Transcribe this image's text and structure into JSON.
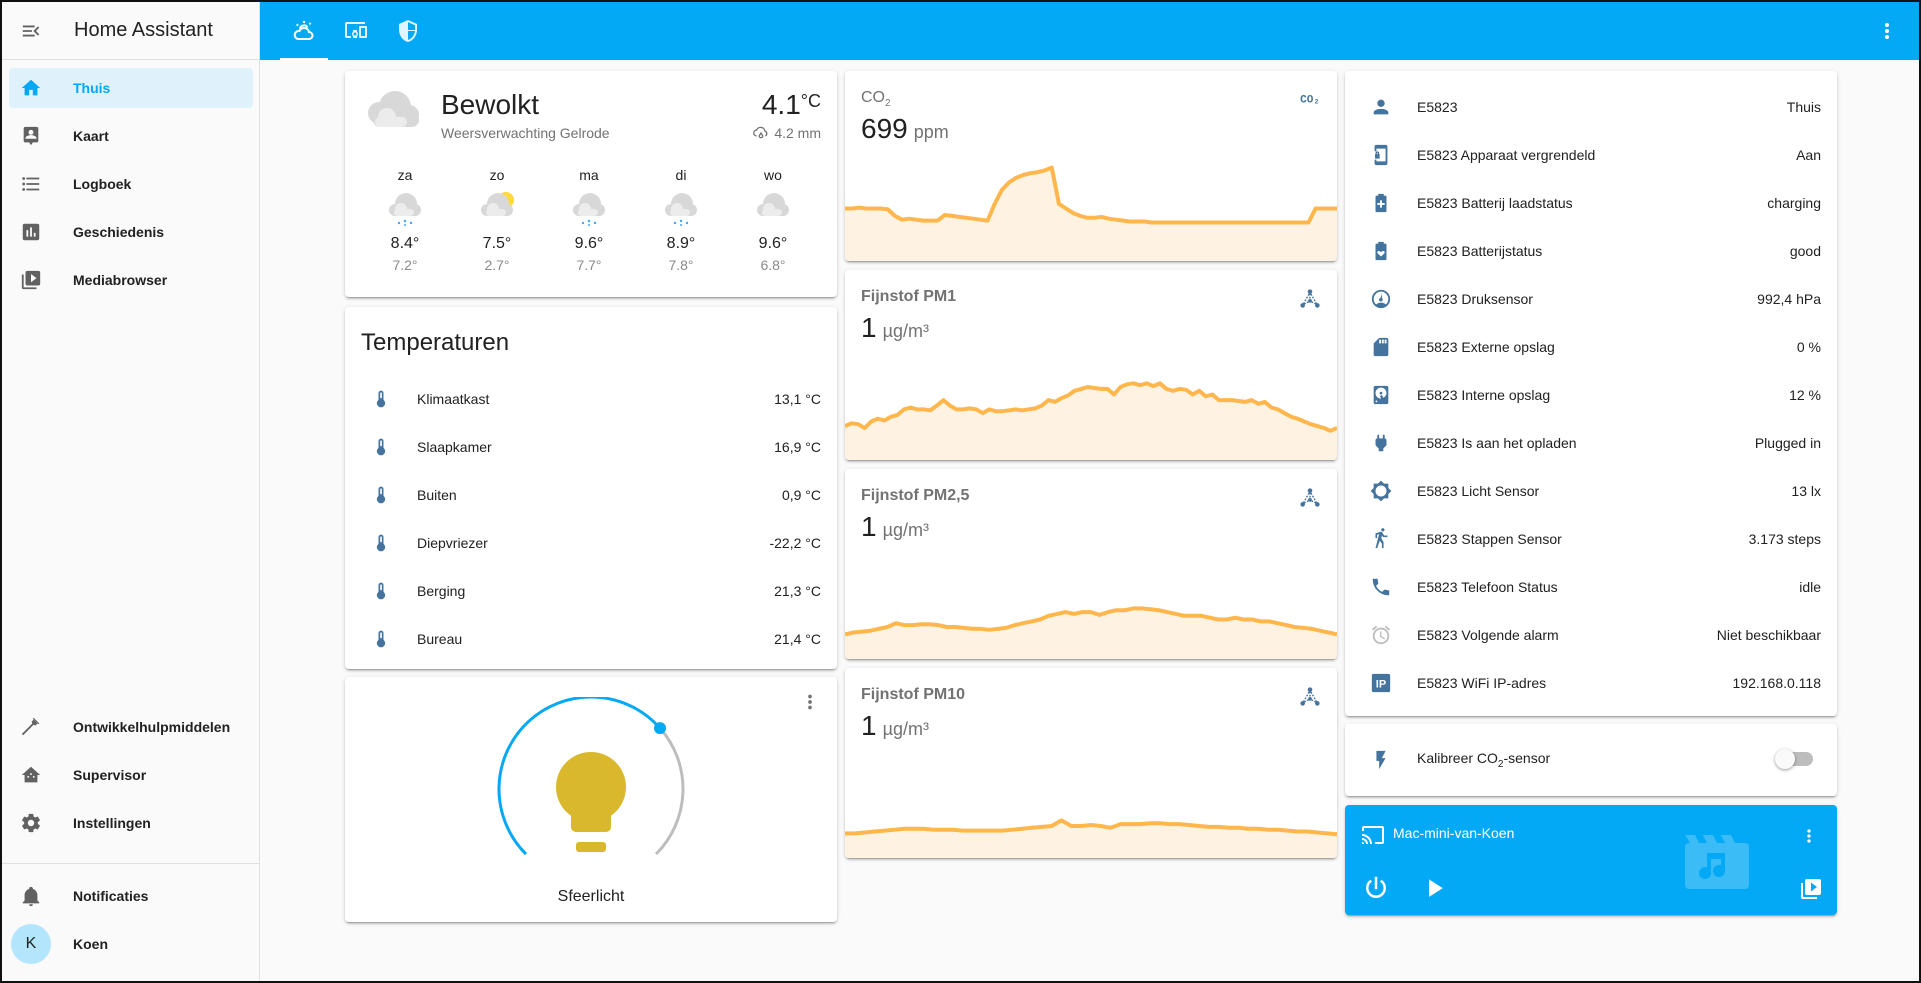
{
  "app": {
    "title": "Home Assistant"
  },
  "sidebar": {
    "items": [
      {
        "label": "Thuis",
        "icon": "home-icon",
        "active": true
      },
      {
        "label": "Kaart",
        "icon": "account-box-icon"
      },
      {
        "label": "Logboek",
        "icon": "format-list-bulleted-icon"
      },
      {
        "label": "Geschiedenis",
        "icon": "chart-box-icon"
      },
      {
        "label": "Mediabrowser",
        "icon": "play-box-multiple-icon"
      }
    ],
    "bottom_items": [
      {
        "label": "Ontwikkelhulpmiddelen",
        "icon": "hammer-icon"
      },
      {
        "label": "Supervisor",
        "icon": "home-assistant-icon"
      },
      {
        "label": "Instellingen",
        "icon": "cog-icon"
      }
    ],
    "notifications_label": "Notificaties",
    "user": {
      "name": "Koen",
      "initial": "K"
    }
  },
  "topbar": {
    "tabs": [
      {
        "icon": "weather-partly-cloudy-icon",
        "active": true
      },
      {
        "icon": "devices-icon"
      },
      {
        "icon": "shield-half-icon"
      }
    ]
  },
  "weather": {
    "condition": "Bewolkt",
    "location": "Weersverwachting Gelrode",
    "temperature": "4.1",
    "temperature_unit": "°C",
    "precipitation": "4.2 mm",
    "forecast": [
      {
        "day": "za",
        "icon": "snowy-cloud",
        "high": "8.4°",
        "low": "7.2°"
      },
      {
        "day": "zo",
        "icon": "partly-cloudy",
        "high": "7.5°",
        "low": "2.7°"
      },
      {
        "day": "ma",
        "icon": "snowy-cloud",
        "high": "9.6°",
        "low": "7.7°"
      },
      {
        "day": "di",
        "icon": "snowy-cloud",
        "high": "8.9°",
        "low": "7.8°"
      },
      {
        "day": "wo",
        "icon": "cloudy",
        "high": "9.6°",
        "low": "6.8°"
      }
    ]
  },
  "temperatures": {
    "title": "Temperaturen",
    "rows": [
      {
        "name": "Klimaatkast",
        "value": "13,1 °C"
      },
      {
        "name": "Slaapkamer",
        "value": "16,9 °C"
      },
      {
        "name": "Buiten",
        "value": "0,9 °C"
      },
      {
        "name": "Diepvriezer",
        "value": "-22,2 °C"
      },
      {
        "name": "Berging",
        "value": "21,3 °C"
      },
      {
        "name": "Bureau",
        "value": "21,4 °C"
      }
    ]
  },
  "light": {
    "name": "Sfeerlicht",
    "brightness_percent": 68,
    "color": "#d9b82e",
    "accent": "#03a9f4"
  },
  "sensors": [
    {
      "name": "CO",
      "name_sub": "2",
      "value": "699",
      "unit": "ppm",
      "icon": "molecule-co2-icon",
      "history": [
        50,
        50,
        51,
        50,
        50,
        50,
        49,
        42,
        38,
        39,
        38,
        37,
        37,
        37,
        43,
        42,
        41,
        40,
        39,
        38,
        37,
        55,
        70,
        78,
        83,
        86,
        88,
        89,
        91,
        94,
        55,
        50,
        45,
        42,
        40,
        40,
        41,
        39,
        38,
        37,
        36,
        36,
        36,
        35,
        35,
        35,
        35,
        35,
        35,
        35,
        35,
        35,
        35,
        35,
        35,
        35,
        35,
        35,
        35,
        35,
        35,
        35,
        35,
        35,
        35,
        35,
        50,
        50,
        50,
        50
      ]
    },
    {
      "name": "Fijnstof PM1",
      "value": "1",
      "unit": "µg/m³",
      "icon": "molecule-icon",
      "history": [
        30,
        33,
        32,
        28,
        35,
        38,
        36,
        40,
        42,
        48,
        50,
        48,
        48,
        47,
        52,
        58,
        52,
        48,
        48,
        49,
        48,
        44,
        48,
        46,
        46,
        47,
        48,
        47,
        48,
        49,
        52,
        58,
        56,
        60,
        63,
        68,
        70,
        72,
        71,
        70,
        70,
        64,
        72,
        75,
        76,
        74,
        76,
        73,
        76,
        70,
        68,
        70,
        69,
        64,
        68,
        62,
        64,
        58,
        58,
        58,
        57,
        56,
        58,
        54,
        56,
        50,
        48,
        44,
        40,
        38,
        35,
        32,
        30,
        28,
        25,
        28
      ]
    },
    {
      "name": "Fijnstof PM2,5",
      "value": "1",
      "unit": "µg/m³",
      "icon": "molecule-icon",
      "history": [
        20,
        22,
        23,
        24,
        26,
        28,
        32,
        30,
        30,
        31,
        31,
        30,
        28,
        28,
        27,
        26,
        26,
        25,
        26,
        27,
        30,
        32,
        34,
        36,
        40,
        42,
        44,
        42,
        44,
        44,
        41,
        44,
        46,
        46,
        48,
        48,
        47,
        46,
        44,
        42,
        40,
        40,
        40,
        38,
        36,
        36,
        38,
        36,
        36,
        34,
        34,
        32,
        30,
        28,
        27,
        26,
        24,
        22,
        20
      ]
    },
    {
      "name": "Fijnstof PM10",
      "value": "1",
      "unit": "µg/m³",
      "icon": "molecule-icon",
      "history": [
        20,
        20,
        21,
        22,
        23,
        24,
        25,
        25,
        25,
        24,
        24,
        24,
        23,
        23,
        23,
        23,
        23,
        24,
        25,
        26,
        27,
        28,
        34,
        28,
        28,
        29,
        28,
        26,
        30,
        30,
        30,
        31,
        31,
        30,
        30,
        29,
        28,
        27,
        27,
        26,
        26,
        25,
        25,
        24,
        24,
        23,
        22,
        22,
        21,
        20,
        19
      ]
    }
  ],
  "phone": {
    "rows": [
      {
        "name": "E5823",
        "value": "Thuis",
        "icon": "account-icon"
      },
      {
        "name": "E5823 Apparaat vergrendeld",
        "value": "Aan",
        "icon": "cellphone-lock-icon"
      },
      {
        "name": "E5823 Batterij laadstatus",
        "value": "charging",
        "icon": "battery-plus-icon"
      },
      {
        "name": "E5823 Batterijstatus",
        "value": "good",
        "icon": "battery-heart-icon"
      },
      {
        "name": "E5823 Druksensor",
        "value": "992,4 hPa",
        "icon": "gauge-icon"
      },
      {
        "name": "E5823 Externe opslag",
        "value": "0 %",
        "icon": "sd-card-icon"
      },
      {
        "name": "E5823 Interne opslag",
        "value": "12 %",
        "icon": "harddisk-icon"
      },
      {
        "name": "E5823 Is aan het opladen",
        "value": "Plugged in",
        "icon": "power-plug-icon"
      },
      {
        "name": "E5823 Licht Sensor",
        "value": "13 lx",
        "icon": "brightness-icon"
      },
      {
        "name": "E5823 Stappen Sensor",
        "value": "3.173 steps",
        "icon": "walk-icon"
      },
      {
        "name": "E5823 Telefoon Status",
        "value": "idle",
        "icon": "phone-icon"
      },
      {
        "name": "E5823 Volgende alarm",
        "value": "Niet beschikbaar",
        "icon": "alarm-icon"
      },
      {
        "name": "E5823 WiFi IP-adres",
        "value": "192.168.0.118",
        "icon": "ip-icon"
      }
    ]
  },
  "switch": {
    "label_pre": "Kalibreer CO",
    "label_sub": "2",
    "label_post": "-sensor",
    "state": "off"
  },
  "media": {
    "name": "Mac-mini-van-Koen",
    "background": "#03a9f4"
  },
  "colors": {
    "primary": "#03a9f4",
    "icon": "#44739e",
    "graph_line": "#ffb74d",
    "graph_fill": "#fef3e2"
  }
}
